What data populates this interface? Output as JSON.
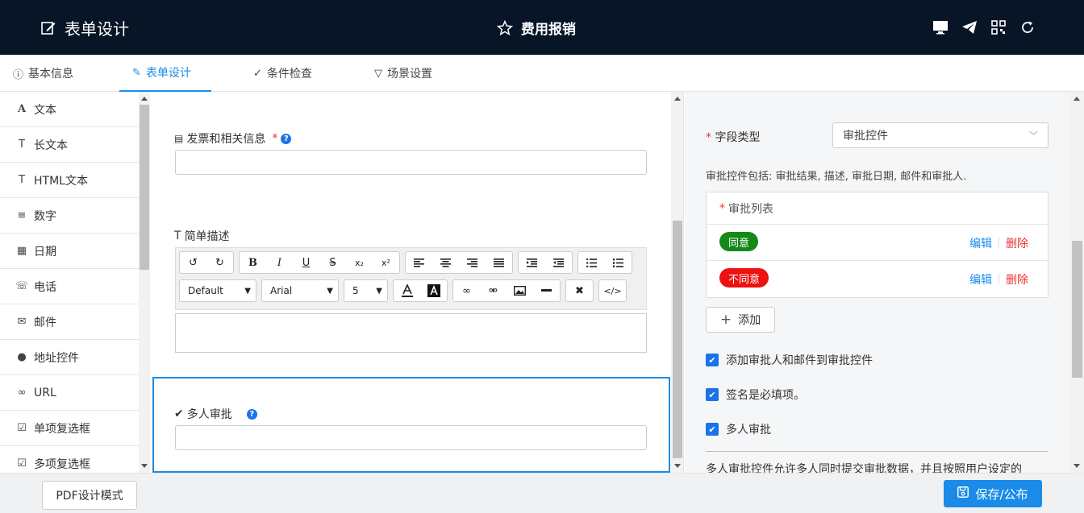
{
  "header": {
    "left_title": "表单设计",
    "center_title": "费用报销"
  },
  "tabs": [
    {
      "label": "基本信息"
    },
    {
      "label": "表单设计"
    },
    {
      "label": "条件检查"
    },
    {
      "label": "场景设置"
    }
  ],
  "sidebar": {
    "items": [
      {
        "label": "文本",
        "icon": "A"
      },
      {
        "label": "长文本",
        "icon": "T"
      },
      {
        "label": "HTML文本",
        "icon": "T"
      },
      {
        "label": "数字",
        "icon": "≡"
      },
      {
        "label": "日期",
        "icon": "▦"
      },
      {
        "label": "电话",
        "icon": "☏"
      },
      {
        "label": "邮件",
        "icon": "✉"
      },
      {
        "label": "地址控件",
        "icon": "●"
      },
      {
        "label": "URL",
        "icon": "∞"
      },
      {
        "label": "单项复选框",
        "icon": "☑"
      },
      {
        "label": "多项复选框",
        "icon": "☑"
      }
    ]
  },
  "form": {
    "field1_label": "发票和相关信息",
    "field1_required": "*",
    "field2_label": "简单描述",
    "field3_label": "多人审批",
    "help": "?",
    "editor": {
      "undo": "↺",
      "redo": "↻",
      "bold": "B",
      "italic": "I",
      "underline": "U",
      "strike": "S",
      "sub": "x₂",
      "sup": "x²",
      "format_select": "Default",
      "font_select": "Arial",
      "size_select": "5"
    }
  },
  "panel": {
    "field_type_label": "字段类型",
    "required_mark": "*",
    "field_type_value": "审批控件",
    "note": "审批控件包括: 审批结果, 描述, 审批日期, 邮件和审批人.",
    "list_header": "审批列表",
    "rows": [
      {
        "badge": "同意",
        "color": "#138a17",
        "edit": "编辑",
        "delete": "删除"
      },
      {
        "badge": "不同意",
        "color": "#ee1111",
        "edit": "编辑",
        "delete": "删除"
      }
    ],
    "add_label": "添加",
    "checks": [
      {
        "label": "添加审批人和邮件到审批控件"
      },
      {
        "label": "签名是必填项。"
      },
      {
        "label": "多人审批"
      }
    ],
    "desc": "多人审批控件允许多人同时提交审批数据，并且按照用户设定的"
  },
  "footer": {
    "pdf_button": "PDF设计模式",
    "save_button": "保存/公布"
  }
}
